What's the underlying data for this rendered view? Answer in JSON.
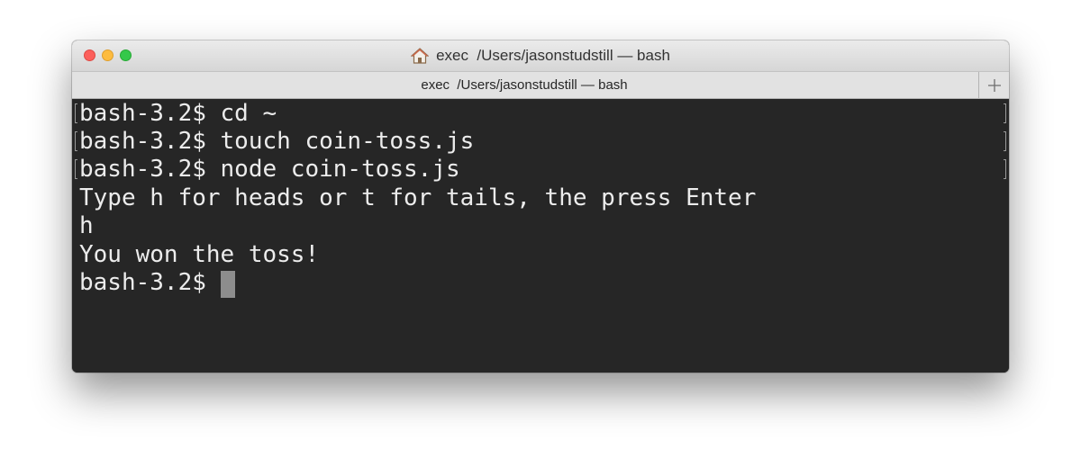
{
  "window": {
    "title": "exec  /Users/jasonstudstill — bash"
  },
  "titlebar_icon": "home-icon",
  "tab": {
    "label": "exec  /Users/jasonstudstill — bash"
  },
  "new_tab_icon": "plus-icon",
  "terminal": {
    "lines": [
      "bash-3.2$ cd ~",
      "bash-3.2$ touch coin-toss.js",
      "bash-3.2$ node coin-toss.js",
      "Type h for heads or t for tails, the press Enter",
      "h",
      "You won the toss!",
      "bash-3.2$ "
    ]
  },
  "colors": {
    "terminal_background": "#262626",
    "terminal_text": "#ececec",
    "cursor": "#8d8d8d",
    "traffic_close": "#fc605c",
    "traffic_minimize": "#fdbc40",
    "traffic_zoom": "#34c84a"
  }
}
